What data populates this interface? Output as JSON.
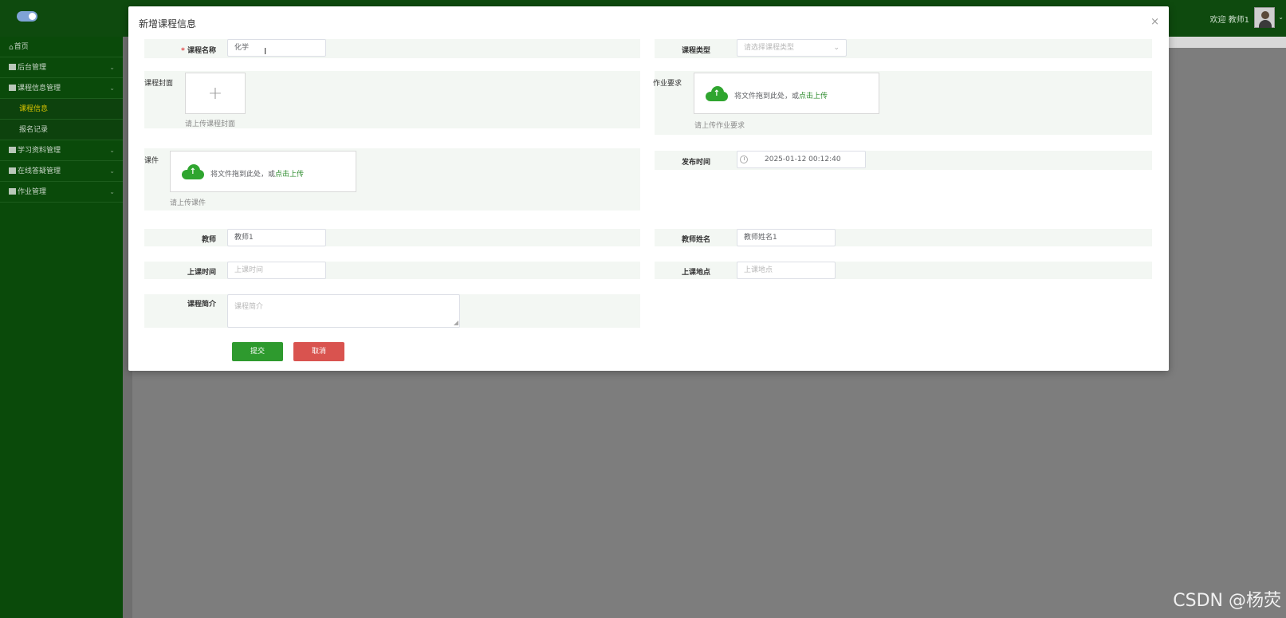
{
  "header": {
    "welcome": "欢迎 教师1",
    "avatar_caret": "⌄"
  },
  "sidebar": {
    "items": [
      {
        "label": "首页",
        "icon": "home-icon"
      },
      {
        "label": "后台管理",
        "icon": "table-icon",
        "chev": "⌄"
      },
      {
        "label": "课程信息管理",
        "icon": "table-icon",
        "chev": "⌄"
      },
      {
        "label": "课程信息",
        "sub": true,
        "active": true
      },
      {
        "label": "报名记录",
        "sub": true
      },
      {
        "label": "学习资料管理",
        "icon": "folder-icon",
        "chev": "⌄"
      },
      {
        "label": "在线答疑管理",
        "icon": "table-icon",
        "chev": "⌄"
      },
      {
        "label": "作业管理",
        "icon": "edit-icon",
        "chev": "⌄"
      }
    ]
  },
  "dialog": {
    "title": "新增课程信息",
    "close": "×",
    "course_name": {
      "required_mark": "*",
      "label": "课程名称",
      "value": "化学"
    },
    "course_type": {
      "label": "课程类型",
      "placeholder": "请选择课程类型",
      "arrow": "⌄"
    },
    "course_cover": {
      "label": "课程封面",
      "plus": "+",
      "hint": "请上传课程封面"
    },
    "homework": {
      "label": "作业要求",
      "drop_text": "将文件拖到此处，或",
      "drop_link": "点击上传",
      "hint": "请上传作业要求"
    },
    "courseware": {
      "label": "课件",
      "drop_text": "将文件拖到此处，或",
      "drop_link": "点击上传",
      "hint": "请上传课件"
    },
    "publish_time": {
      "label": "发布时间",
      "value": "2025-01-12 00:12:40"
    },
    "teacher": {
      "label": "教师",
      "value": "教师1"
    },
    "teacher_name": {
      "label": "教师姓名",
      "value": "教师姓名1"
    },
    "class_time": {
      "label": "上课时间",
      "placeholder": "上课时间"
    },
    "class_place": {
      "label": "上课地点",
      "placeholder": "上课地点"
    },
    "intro": {
      "label": "课程简介",
      "placeholder": "课程简介"
    },
    "submit_label": "提交",
    "cancel_label": "取消"
  },
  "watermark": "CSDN @杨荧",
  "colors": {
    "header_bg": "#0e4a0e",
    "sidebar_bg": "#0a4a0a",
    "active_menu": "#d9c400",
    "submit": "#2e9a2e",
    "cancel": "#d9534f",
    "upload_icon": "#2fa52f"
  }
}
